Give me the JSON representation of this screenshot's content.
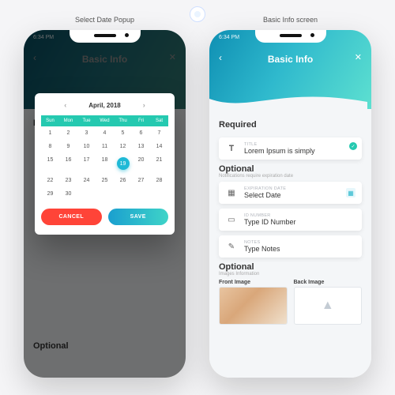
{
  "annotations": {
    "left": "Select Date Popup",
    "right": "Basic Info screen"
  },
  "status_time": "6:34 PM",
  "header": {
    "title": "Basic Info",
    "back": "‹",
    "close": "✕"
  },
  "sections": {
    "required": {
      "title": "Required",
      "sub": ""
    },
    "optional1": {
      "title": "Optional",
      "sub": "Notifications require expiration date"
    },
    "optional2": {
      "title": "Optional",
      "sub": "Images Information"
    }
  },
  "fields": {
    "title": {
      "label": "TITLE",
      "value": "Lorem Ipsum is simply"
    },
    "exp": {
      "label": "EXPIRATION DATE",
      "value": "Select Date"
    },
    "idnum": {
      "label": "ID NUMBER",
      "value": "Type ID Number"
    },
    "notes": {
      "label": "NOTES",
      "value": "Type Notes"
    }
  },
  "images": {
    "front": "Front Image",
    "back": "Back Image"
  },
  "popup": {
    "month": "April, 2018",
    "dow": [
      "Sun",
      "Mon",
      "Tue",
      "Wed",
      "Thu",
      "Fri",
      "Sat"
    ],
    "selected_day": 19,
    "cancel": "CANCEL",
    "save": "SAVE"
  },
  "bg_labels": {
    "required": "Required",
    "optional": "Optional"
  }
}
